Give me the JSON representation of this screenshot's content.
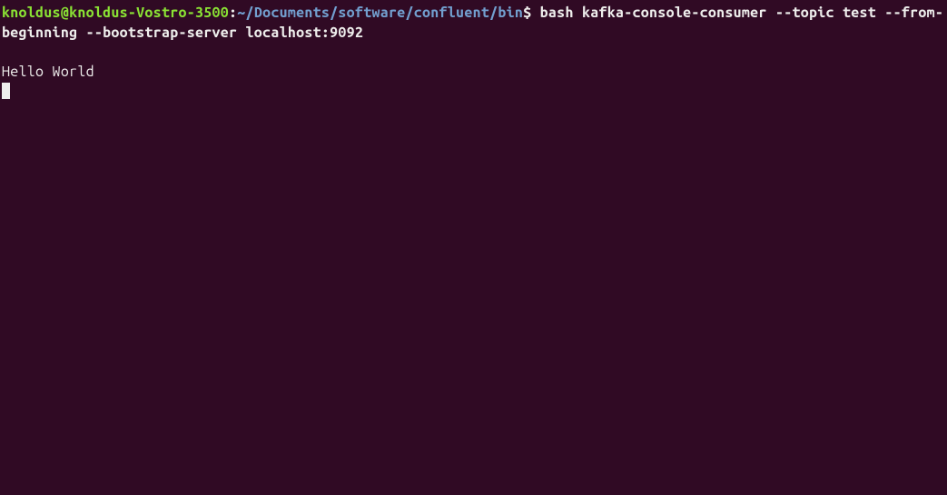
{
  "prompt": {
    "user_host": "knoldus@knoldus-Vostro-3500",
    "colon": ":",
    "path": "~/Documents/software/confluent/bin",
    "dollar": "$"
  },
  "command": " bash kafka-console-consumer --topic test --from-beginning --bootstrap-server localhost:9092",
  "output": {
    "line1": "Hello World"
  }
}
